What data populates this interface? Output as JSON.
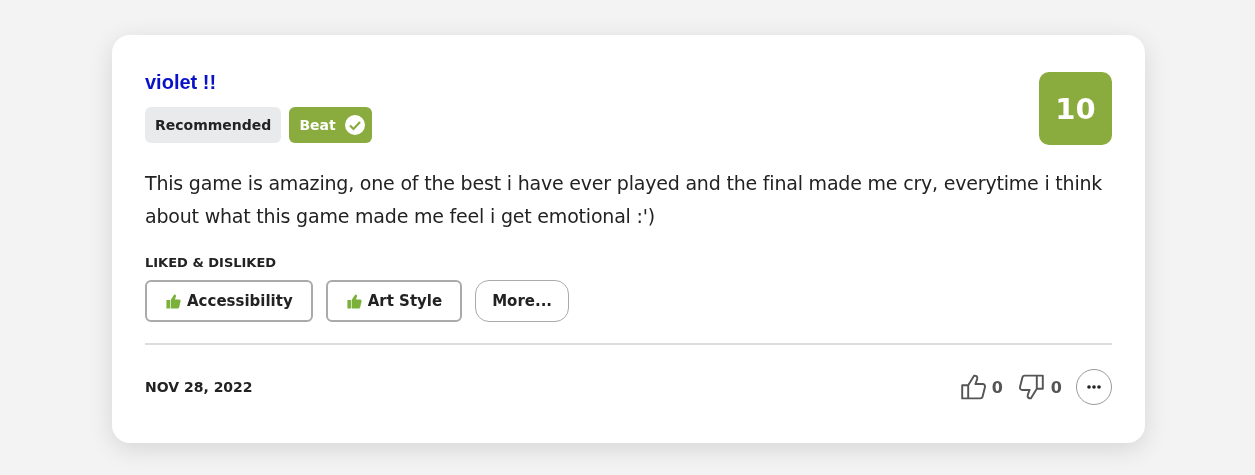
{
  "review": {
    "author": "violet !!",
    "score": "10",
    "badges": [
      {
        "label": "Recommended",
        "kind": "plain"
      },
      {
        "label": "Beat",
        "kind": "check"
      }
    ],
    "text": "This game is amazing, one of the best i have ever played and the final made me cry, everytime i think about what this game made me feel i get emotional :')",
    "section_title": "LIKED & DISLIKED",
    "tags": [
      {
        "label": "Accessibility",
        "kind": "liked"
      },
      {
        "label": "Art Style",
        "kind": "liked"
      },
      {
        "label": "More...",
        "kind": "more"
      }
    ],
    "date": "NOV 28, 2022",
    "votes": [
      {
        "kind": "up",
        "count": "0"
      },
      {
        "kind": "down",
        "count": "0"
      }
    ]
  }
}
